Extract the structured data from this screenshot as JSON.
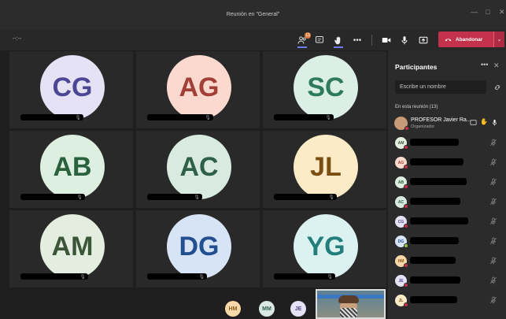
{
  "window": {
    "title": "Reunión en \"General\""
  },
  "toolbar": {
    "timer": "--:--",
    "participants_badge": "13",
    "leave_label": "Abandonar"
  },
  "tiles": [
    {
      "initials": "CG",
      "bg": "#e5e2f5",
      "fg": "#4c4794"
    },
    {
      "initials": "AG",
      "bg": "#fcd9cf",
      "fg": "#a23f36"
    },
    {
      "initials": "SC",
      "bg": "#dcefe7",
      "fg": "#2d7a5c"
    },
    {
      "initials": "AB",
      "bg": "#dcefe0",
      "fg": "#29613c"
    },
    {
      "initials": "AC",
      "bg": "#d9ebe1",
      "fg": "#2e5f48"
    },
    {
      "initials": "JL",
      "bg": "#fcebc6",
      "fg": "#7a4e10"
    },
    {
      "initials": "AM",
      "bg": "#e3eee0",
      "fg": "#3b5538"
    },
    {
      "initials": "DG",
      "bg": "#d7e4f6",
      "fg": "#224f8f"
    },
    {
      "initials": "YG",
      "bg": "#dcf2f1",
      "fg": "#237d7a"
    }
  ],
  "bottom": {
    "avatars": [
      {
        "initials": "HM",
        "bg": "#f8d8a9",
        "fg": "#8a5a1c"
      },
      {
        "initials": "MM",
        "bg": "#d9e8e2",
        "fg": "#2f5e4e"
      },
      {
        "initials": "JE",
        "bg": "#e4e2f4",
        "fg": "#4b4693"
      }
    ]
  },
  "panel": {
    "title": "Participantes",
    "search_placeholder": "Escribe un nombre",
    "section_label": "En esta reunión (13)",
    "organizer": {
      "name": "PROFESOR Javier Ra...",
      "role": "Organizador"
    },
    "participants": [
      {
        "initials": "AM",
        "bg": "#e3eee0",
        "fg": "#3b5538",
        "dot": "#c4314b"
      },
      {
        "initials": "AG",
        "bg": "#fcd9cf",
        "fg": "#a23f36",
        "dot": "#c4314b"
      },
      {
        "initials": "AB",
        "bg": "#dcefe0",
        "fg": "#29613c",
        "dot": "#c4314b"
      },
      {
        "initials": "AC",
        "bg": "#d9ebe1",
        "fg": "#2e5f48",
        "dot": "#c4314b"
      },
      {
        "initials": "CG",
        "bg": "#e5e2f5",
        "fg": "#4c4794",
        "dot": "#c4314b"
      },
      {
        "initials": "DG",
        "bg": "#d7e4f6",
        "fg": "#224f8f",
        "dot": "#92c353"
      },
      {
        "initials": "HM",
        "bg": "#f8d8a9",
        "fg": "#8a5a1c",
        "dot": "#c4314b"
      },
      {
        "initials": "JE",
        "bg": "#e4e2f4",
        "fg": "#4b4693",
        "dot": "#c4314b"
      },
      {
        "initials": "JL",
        "bg": "#fcebc6",
        "fg": "#7a4e10",
        "dot": "#c4314b"
      }
    ]
  },
  "colors": {
    "accent": "#6264a7",
    "leave": "#c4314b"
  }
}
